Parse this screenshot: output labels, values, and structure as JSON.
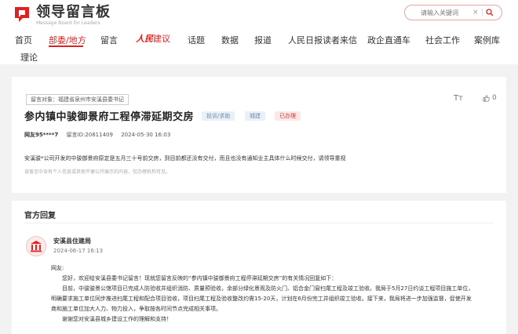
{
  "header": {
    "logo_title": "领导留言板",
    "logo_sub": "Message Board for Leaders",
    "search_placeholder": "请输入关键词",
    "search_clear": "×"
  },
  "nav": [
    {
      "label": "首页"
    },
    {
      "label": "部委/地方"
    },
    {
      "label": "留言"
    },
    {
      "label_logo": "人民",
      "label_rest": "建议"
    },
    {
      "label": "话题"
    },
    {
      "label": "数据"
    },
    {
      "label": "报道"
    },
    {
      "label": "人民日报读者来信"
    },
    {
      "label": "政企直通车"
    },
    {
      "label": "社会工作"
    },
    {
      "label": "案例库"
    },
    {
      "label": "理论"
    }
  ],
  "message": {
    "target": "留言对象：福建省泉州市安溪县委书记",
    "title": "参内镇中骏御景府工程停滞延期交房",
    "tags": [
      "投诉/求助",
      "城建",
      "已办理"
    ],
    "font_size_icon": "Tт",
    "like_count": "0",
    "user": "网友95****7",
    "id_text": "留言ID:20811409",
    "time": "2024-05-30 16:03",
    "content": "安溪骏*公司开发的中骏御景府原定是五月三十号前交房，到目前都还没有交付，而且也没有通知业主具体什么时候交付，请领导重视",
    "notice": "该留言中含有个人信息或其他不便公开展示的内容，仅办理机构可见。"
  },
  "reply": {
    "section_title": "官方回复",
    "org_name": "安溪县住建局",
    "time": "2024-06-17 16:13",
    "lines": [
      "网友:",
      "您好，欢迎给安溪县委书记留言！现就您留言反映的“参内镇中骏御景府工程停滞延期交房”的有关情况回复如下：",
      "目前，中骏骏景公馆项目已完成人防验收并组织消防、质量预验收，余部分绿化景观及防火门、铝合金门窗扫尾工程及竣工验收。我局于5月27日约谈工程项目施工单位，",
      "明确要求施工单位同步推进扫尾工程和配合项目验收，项目扫尾工程及验收整改约需15-20天，计划在6月份完工并组织竣工验收。接下来，我局将进一步加强监督，促使开发",
      "商和施工单位加大人力、物力投入，争取按各时间节点完成相关事项。",
      "谢谢您对安溪县城乡建设工作的理解和支持！"
    ]
  },
  "colors": {
    "accent": "#dd2222",
    "tag_blue_bg": "#eaf0f7",
    "tag_red_bg": "#fde8e8"
  }
}
